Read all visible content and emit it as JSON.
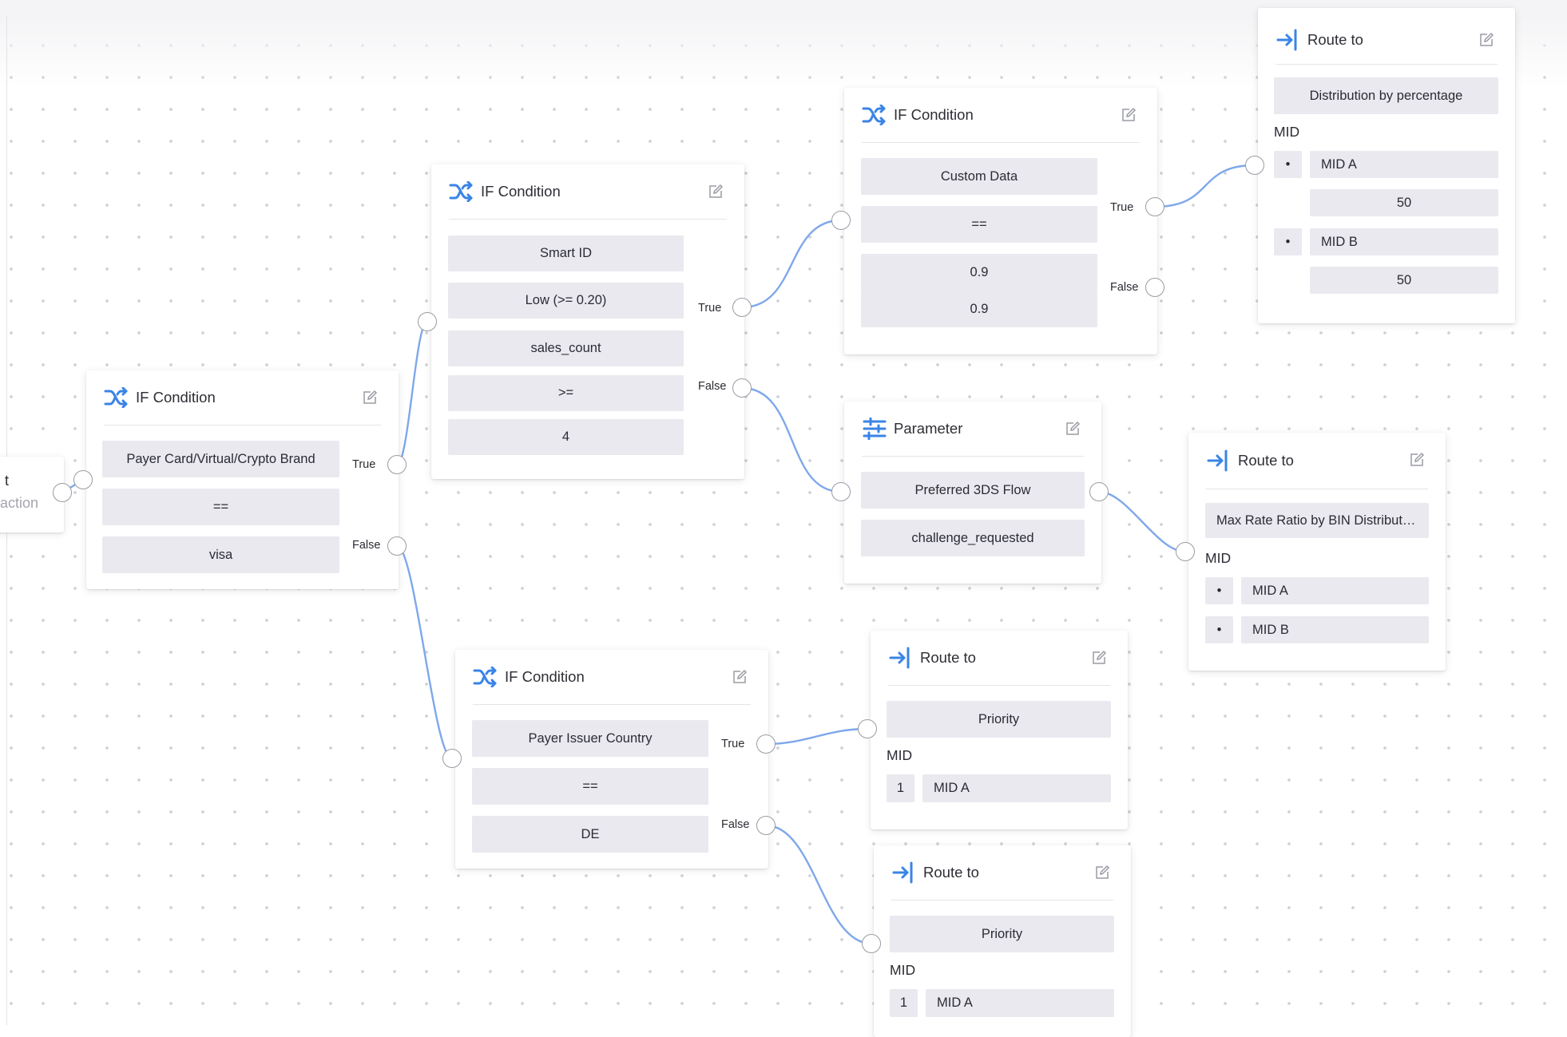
{
  "colors": {
    "accent": "#3a84e6",
    "wire": "#7fa8ea",
    "field_bg": "#e9e9ef"
  },
  "start_node": {
    "line1": "t",
    "line2": "action"
  },
  "nodes": {
    "if1": {
      "title": "IF Condition",
      "icon": "shuffle-icon",
      "fields": [
        "Payer Card/Virtual/Crypto Brand",
        "==",
        "visa"
      ],
      "true_label": "True",
      "false_label": "False"
    },
    "if2": {
      "title": "IF Condition",
      "icon": "shuffle-icon",
      "fields": [
        "Smart ID",
        "Low (>= 0.20)",
        "sales_count",
        ">=",
        "4"
      ],
      "true_label": "True",
      "false_label": "False"
    },
    "if3": {
      "title": "IF Condition",
      "icon": "shuffle-icon",
      "fields": [
        "Custom Data",
        "==",
        "0.9",
        "0.9"
      ],
      "true_label": "True",
      "false_label": "False"
    },
    "if4": {
      "title": "IF Condition",
      "icon": "shuffle-icon",
      "fields": [
        "Payer Issuer Country",
        "==",
        "DE"
      ],
      "true_label": "True",
      "false_label": "False"
    },
    "param": {
      "title": "Parameter",
      "icon": "sliders-icon",
      "fields": [
        "Preferred 3DS Flow",
        "challenge_requested"
      ]
    },
    "route1": {
      "title": "Route to",
      "icon": "route-icon",
      "strategy": "Distribution by percentage",
      "mid_label": "MID",
      "mids": [
        {
          "marker": "•",
          "name": "MID A",
          "pct": "50"
        },
        {
          "marker": "•",
          "name": "MID B",
          "pct": "50"
        }
      ]
    },
    "route2": {
      "title": "Route to",
      "icon": "route-icon",
      "strategy": "Max Rate Ratio by BIN Distribution",
      "mid_label": "MID",
      "mids": [
        {
          "marker": "•",
          "name": "MID A"
        },
        {
          "marker": "•",
          "name": "MID B"
        }
      ]
    },
    "route3": {
      "title": "Route to",
      "icon": "route-icon",
      "strategy": "Priority",
      "mid_label": "MID",
      "mids": [
        {
          "marker": "1",
          "name": "MID A"
        }
      ]
    },
    "route4": {
      "title": "Route to",
      "icon": "route-icon",
      "strategy": "Priority",
      "mid_label": "MID",
      "mids": [
        {
          "marker": "1",
          "name": "MID A"
        }
      ]
    }
  }
}
